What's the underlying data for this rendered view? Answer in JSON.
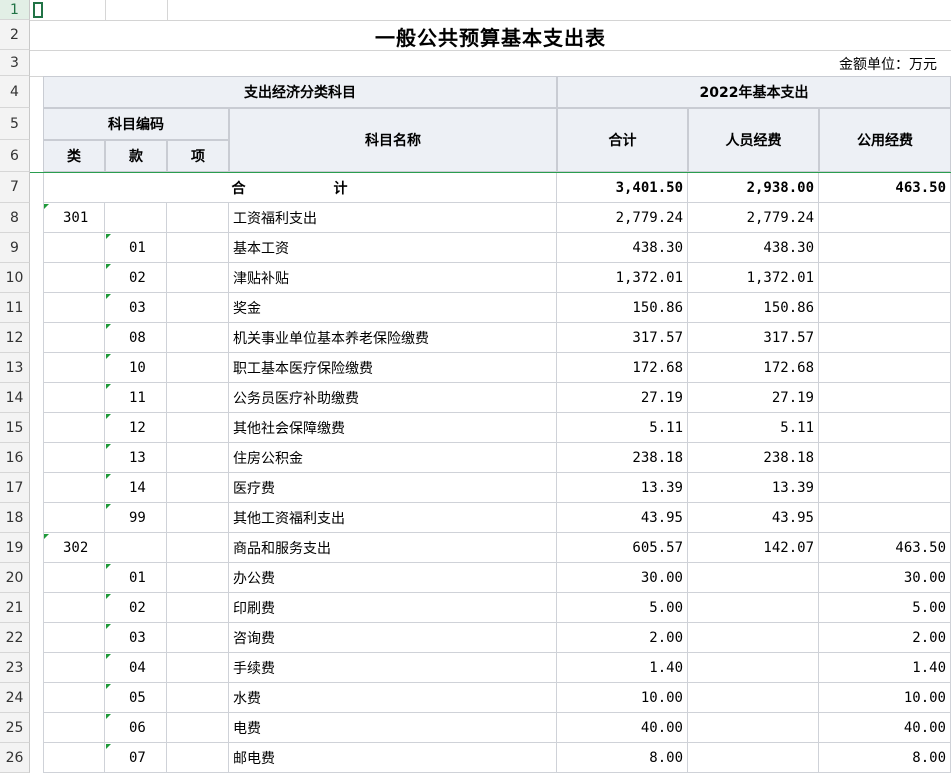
{
  "sheet": {
    "title": "一般公共预算基本支出表",
    "unit_label": "金额单位：万元",
    "header": {
      "econ_category": "支出经济分类科目",
      "year_expense": "2022年基本支出",
      "subject_code": "科目编码",
      "subject_name": "科目名称",
      "lei": "类",
      "kuan": "款",
      "xiang": "项",
      "total": "合计",
      "personnel": "人员经费",
      "public": "公用经费"
    },
    "total_row": {
      "label": "合　　计",
      "total": "3,401.50",
      "personnel": "2,938.00",
      "public": "463.50"
    },
    "rows": [
      {
        "lei": "301",
        "kuan": "",
        "name": "工资福利支出",
        "total": "2,779.24",
        "personnel": "2,779.24",
        "public": ""
      },
      {
        "lei": "",
        "kuan": "01",
        "name": "基本工资",
        "total": "438.30",
        "personnel": "438.30",
        "public": ""
      },
      {
        "lei": "",
        "kuan": "02",
        "name": "津贴补贴",
        "total": "1,372.01",
        "personnel": "1,372.01",
        "public": ""
      },
      {
        "lei": "",
        "kuan": "03",
        "name": "奖金",
        "total": "150.86",
        "personnel": "150.86",
        "public": ""
      },
      {
        "lei": "",
        "kuan": "08",
        "name": "机关事业单位基本养老保险缴费",
        "total": "317.57",
        "personnel": "317.57",
        "public": ""
      },
      {
        "lei": "",
        "kuan": "10",
        "name": "职工基本医疗保险缴费",
        "total": "172.68",
        "personnel": "172.68",
        "public": ""
      },
      {
        "lei": "",
        "kuan": "11",
        "name": "公务员医疗补助缴费",
        "total": "27.19",
        "personnel": "27.19",
        "public": ""
      },
      {
        "lei": "",
        "kuan": "12",
        "name": "其他社会保障缴费",
        "total": "5.11",
        "personnel": "5.11",
        "public": ""
      },
      {
        "lei": "",
        "kuan": "13",
        "name": "住房公积金",
        "total": "238.18",
        "personnel": "238.18",
        "public": ""
      },
      {
        "lei": "",
        "kuan": "14",
        "name": "医疗费",
        "total": "13.39",
        "personnel": "13.39",
        "public": ""
      },
      {
        "lei": "",
        "kuan": "99",
        "name": "其他工资福利支出",
        "total": "43.95",
        "personnel": "43.95",
        "public": ""
      },
      {
        "lei": "302",
        "kuan": "",
        "name": "商品和服务支出",
        "total": "605.57",
        "personnel": "142.07",
        "public": "463.50"
      },
      {
        "lei": "",
        "kuan": "01",
        "name": "办公费",
        "total": "30.00",
        "personnel": "",
        "public": "30.00"
      },
      {
        "lei": "",
        "kuan": "02",
        "name": "印刷费",
        "total": "5.00",
        "personnel": "",
        "public": "5.00"
      },
      {
        "lei": "",
        "kuan": "03",
        "name": "咨询费",
        "total": "2.00",
        "personnel": "",
        "public": "2.00"
      },
      {
        "lei": "",
        "kuan": "04",
        "name": "手续费",
        "total": "1.40",
        "personnel": "",
        "public": "1.40"
      },
      {
        "lei": "",
        "kuan": "05",
        "name": "水费",
        "total": "10.00",
        "personnel": "",
        "public": "10.00"
      },
      {
        "lei": "",
        "kuan": "06",
        "name": "电费",
        "total": "40.00",
        "personnel": "",
        "public": "40.00"
      },
      {
        "lei": "",
        "kuan": "07",
        "name": "邮电费",
        "total": "8.00",
        "personnel": "",
        "public": "8.00"
      }
    ],
    "row_numbers": [
      "1",
      "2",
      "3",
      "4",
      "5",
      "6",
      "7",
      "8",
      "9",
      "10",
      "11",
      "12",
      "13",
      "14",
      "15",
      "16",
      "17",
      "18",
      "19",
      "20",
      "21",
      "22",
      "23",
      "24",
      "25",
      "26"
    ]
  },
  "colors": {
    "header_bg": "#edf0f5",
    "row_header_bg": "#f3f3f3",
    "selection": "#217346",
    "comment_marker": "#1f9a3a"
  }
}
